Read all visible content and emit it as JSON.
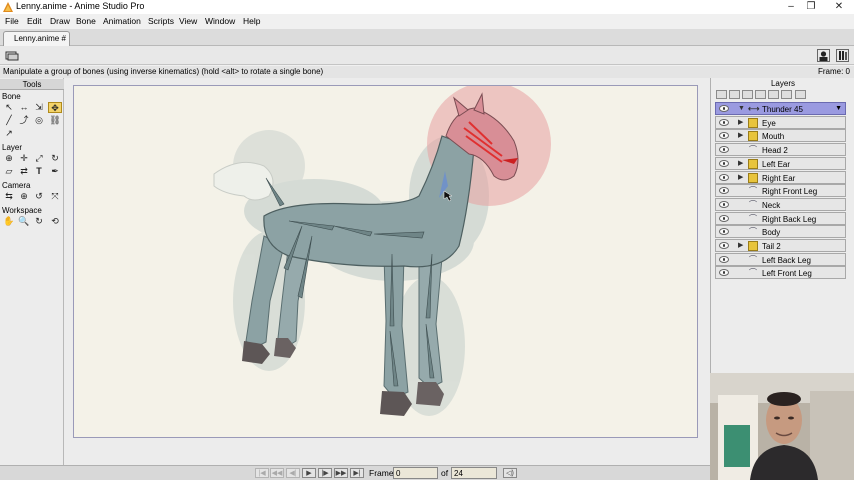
{
  "window": {
    "title": "Lenny.anime - Anime Studio Pro",
    "controls": [
      "–",
      "❐",
      "✕"
    ]
  },
  "menu": [
    "File",
    "Edit",
    "Draw",
    "Bone",
    "Animation",
    "Scripts",
    "View",
    "Window",
    "Help"
  ],
  "tab": {
    "label": "Lenny.anime #"
  },
  "status": {
    "message": "Manipulate a group of bones (using inverse kinematics) (hold <alt> to rotate a single bone)",
    "frame_readout": "Frame: 0"
  },
  "tools": {
    "title": "Tools",
    "sections": [
      {
        "label": "Bone"
      },
      {
        "label": "Layer"
      },
      {
        "label": "Camera"
      },
      {
        "label": "Workspace"
      }
    ],
    "icons": {
      "bone": [
        "select-bone-icon",
        "translate-bone-icon",
        "scale-bone-icon",
        "manipulate-bones-icon",
        "add-bone-icon",
        "reparent-bone-icon",
        "bone-strength-icon",
        "bind-layer-icon",
        "offset-bone-icon"
      ],
      "layer": [
        "set-origin-icon",
        "translate-layer-icon",
        "scale-layer-icon",
        "rotate-layer-icon",
        "shear-layer-icon",
        "switch-layer-icon",
        "insert-text-icon",
        "eyedropper-icon"
      ],
      "camera": [
        "track-camera-icon",
        "zoom-camera-icon",
        "roll-camera-icon",
        "pan-tilt-camera-icon"
      ],
      "workspace": [
        "pan-workspace-icon",
        "zoom-workspace-icon",
        "rotate-workspace-icon",
        "orbit-workspace-icon"
      ]
    },
    "glyphs": {
      "bone": [
        "↖",
        "↔",
        "⇲",
        "✥",
        "╱",
        "⤴",
        "◎",
        "⛓",
        "↗"
      ],
      "layer": [
        "⊕",
        "✛",
        "⤢",
        "↻",
        "▱",
        "⇄",
        "T",
        "✒"
      ],
      "camera": [
        "⇆",
        "⊕",
        "↺",
        "⤧"
      ],
      "workspace": [
        "✋",
        "🔍",
        "↻",
        "⟲"
      ]
    }
  },
  "layers": {
    "title": "Layers",
    "items": [
      {
        "name": "Thunder 45",
        "kind": "bone",
        "selected": true,
        "expandable": true,
        "expanded": true
      },
      {
        "name": "Eye",
        "kind": "folder",
        "selected": false,
        "expandable": true,
        "expanded": false
      },
      {
        "name": "Mouth",
        "kind": "folder",
        "selected": false,
        "expandable": true,
        "expanded": false
      },
      {
        "name": "Head 2",
        "kind": "vector",
        "selected": false,
        "expandable": false
      },
      {
        "name": "Left Ear",
        "kind": "folder",
        "selected": false,
        "expandable": true,
        "expanded": false
      },
      {
        "name": "Right Ear",
        "kind": "folder",
        "selected": false,
        "expandable": true,
        "expanded": false
      },
      {
        "name": "Right Front Leg",
        "kind": "vector",
        "selected": false,
        "expandable": false
      },
      {
        "name": "Neck",
        "kind": "vector",
        "selected": false,
        "expandable": false
      },
      {
        "name": "Right Back Leg",
        "kind": "vector",
        "selected": false,
        "expandable": false
      },
      {
        "name": "Body",
        "kind": "vector",
        "selected": false,
        "expandable": false
      },
      {
        "name": "Tail 2",
        "kind": "folder",
        "selected": false,
        "expandable": true,
        "expanded": false
      },
      {
        "name": "Left Back Leg",
        "kind": "vector",
        "selected": false,
        "expandable": false
      },
      {
        "name": "Left Front Leg",
        "kind": "vector",
        "selected": false,
        "expandable": false
      }
    ]
  },
  "timeline": {
    "frame_label": "Frame",
    "frame_value": "0",
    "of_label": "of",
    "total_frames": "24"
  },
  "colors": {
    "selected_layer": "#9a9ae0",
    "canvas_bg": "#f4f2e8",
    "active_bone": "#e03030",
    "bone_region": "#e8a0a0",
    "horse_body": "#8ca2a4"
  }
}
